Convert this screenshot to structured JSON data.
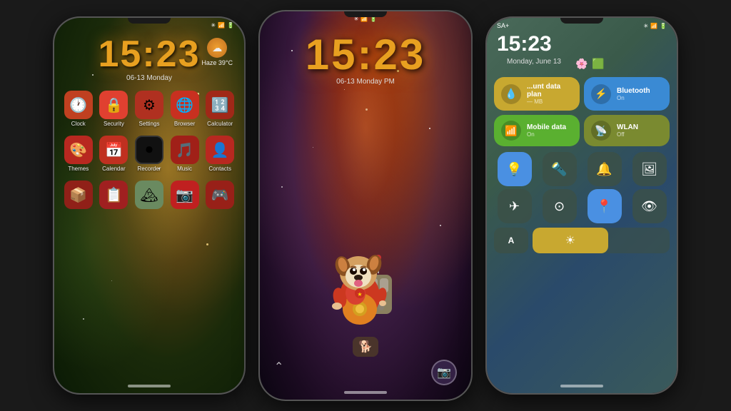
{
  "phone1": {
    "time": "15:23",
    "date": "06-13 Monday",
    "weather": "Haze 39°C",
    "status_icons": "⚡ 🔋",
    "apps_row1": [
      {
        "label": "Clock",
        "emoji": "🕐",
        "bg": "#c04020"
      },
      {
        "label": "Security",
        "emoji": "🔐",
        "bg": "#e04030"
      },
      {
        "label": "Settings",
        "emoji": "⚙️",
        "bg": "#b03020"
      },
      {
        "label": "Browser",
        "emoji": "🌐",
        "bg": "#c83020"
      },
      {
        "label": "Calculator",
        "emoji": "🧮",
        "bg": "#a02818"
      }
    ],
    "apps_row2": [
      {
        "label": "Themes",
        "emoji": "🎨",
        "bg": "#b82820"
      },
      {
        "label": "Calendar",
        "emoji": "📅",
        "bg": "#c03020"
      },
      {
        "label": "Recorder",
        "emoji": "⏺️",
        "bg": "#1a1a1a"
      },
      {
        "label": "Music",
        "emoji": "🎵",
        "bg": "#a02018"
      },
      {
        "label": "Contacts",
        "emoji": "👤",
        "bg": "#b82820"
      }
    ],
    "apps_row3": [
      {
        "label": "",
        "emoji": "📦",
        "bg": "#902018"
      },
      {
        "label": "",
        "emoji": "📋",
        "bg": "#a02020"
      },
      {
        "label": "",
        "emoji": "🏔️",
        "bg": "#8a1818"
      },
      {
        "label": "",
        "emoji": "📷",
        "bg": "#c02020"
      },
      {
        "label": "",
        "emoji": "🎮",
        "bg": "#982018"
      }
    ]
  },
  "phone2": {
    "time": "15:23",
    "date": "06-13 Monday PM",
    "status_icons": "⚡ 🔋"
  },
  "phone3": {
    "time": "15:23",
    "date": "Monday, June 13",
    "operator": "SA+",
    "status_icons": "⚡ 🔋",
    "tile_data": {
      "data_plan_title": "...unt data plan",
      "data_plan_sub": "— MB",
      "bluetooth_title": "Bluetooth",
      "bluetooth_sub": "On",
      "mobile_data_title": "Mobile data",
      "mobile_data_sub": "On",
      "wlan_title": "WLAN",
      "wlan_sub": "Off"
    }
  }
}
